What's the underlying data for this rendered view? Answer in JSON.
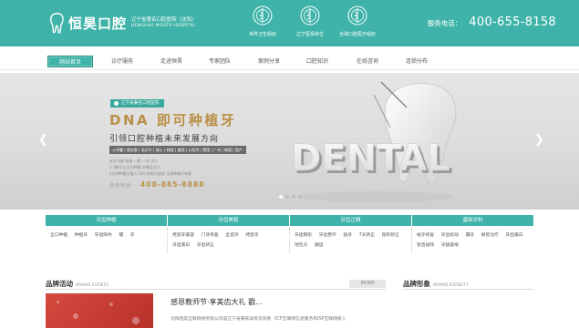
{
  "header": {
    "brand": "恒昊口腔",
    "name_cn": "辽宁省著名口腔医院（沈阳）",
    "name_en": "HENGHAO MOUTH HOSPITAL",
    "badges": [
      {
        "label": "世界卫生组织",
        "icon": "who-emblem-icon"
      },
      {
        "label": "辽宁医保单位",
        "icon": "who-emblem-icon"
      },
      {
        "label": "全球口腔医疗组织",
        "icon": "who-emblem-icon"
      }
    ],
    "hotline_label": "服务电话：",
    "hotline_number": "400-655-8158"
  },
  "nav": {
    "items": [
      {
        "label": "网站首页",
        "active": true
      },
      {
        "label": "诊疗服务",
        "active": false
      },
      {
        "label": "走进恒昊",
        "active": false
      },
      {
        "label": "专家团队",
        "active": false
      },
      {
        "label": "案例分享",
        "active": false
      },
      {
        "label": "口腔知识",
        "active": false
      },
      {
        "label": "在线咨询",
        "active": false
      },
      {
        "label": "连锁分布",
        "active": false
      }
    ]
  },
  "banner": {
    "tag": "辽宁省著名口腔医院",
    "headline": "DNA 即可种植牙",
    "subhead": "引领口腔种植未来发展方向",
    "slogans": "士卓曼 | 奥齿泰 | 诺贝尔 | 瑞士 | 韩国 | 美国 | 以色列 | 德国 | 广州 | 韩国 | 国产",
    "small_lines": [
      "安全无痛 快速 一颗 一次 全口",
      "1-3颗可以当天种植 半颗至全口",
      "5分钟种植牙植入 24小时即可使用 牙周种植牙修复"
    ],
    "hotline_label": "咨询电话：",
    "hotline": "400-865-8888",
    "slides": 4,
    "active_slide": 1,
    "colors": {
      "accent": "#3fb3a9",
      "gold": "#b99046"
    }
  },
  "categories": [
    {
      "title": "牙齿种植",
      "items": [
        "全口种植",
        "种植牙",
        "牙齿缺失",
        "镶",
        "牙"
      ]
    },
    {
      "title": "牙齿美容",
      "items": [
        "烤瓷牙美容",
        "门牙修复",
        "全瓷牙",
        "烤瓷牙",
        "牙齿美白",
        "牙齿矫正"
      ]
    },
    {
      "title": "牙齿正畸",
      "items": [
        "牙齿畸形",
        "牙齿整齐",
        "龅牙",
        "7天矫正",
        "隐形矫正",
        "地包天",
        "龋齿"
      ]
    },
    {
      "title": "基础牙科",
      "items": [
        "蛀牙修复",
        "牙齿松动",
        "镶牙",
        "根管治疗",
        "牙齿美白",
        "智齿拔除",
        "牙龈萎缩"
      ]
    }
  ],
  "events": {
    "title": "品牌活动",
    "title_en": "BRAND EVENTS",
    "more": "MORE",
    "headline": "感恩教师节·享美齿大礼 戳...",
    "desc": "沈阳恒昊互联网络有限公司是辽宁省著家具有双资质（ICP互联网信息服务和ISP互联网接入"
  },
  "brand": {
    "title": "品牌形象",
    "title_en": "BRAND IDENEITY"
  }
}
